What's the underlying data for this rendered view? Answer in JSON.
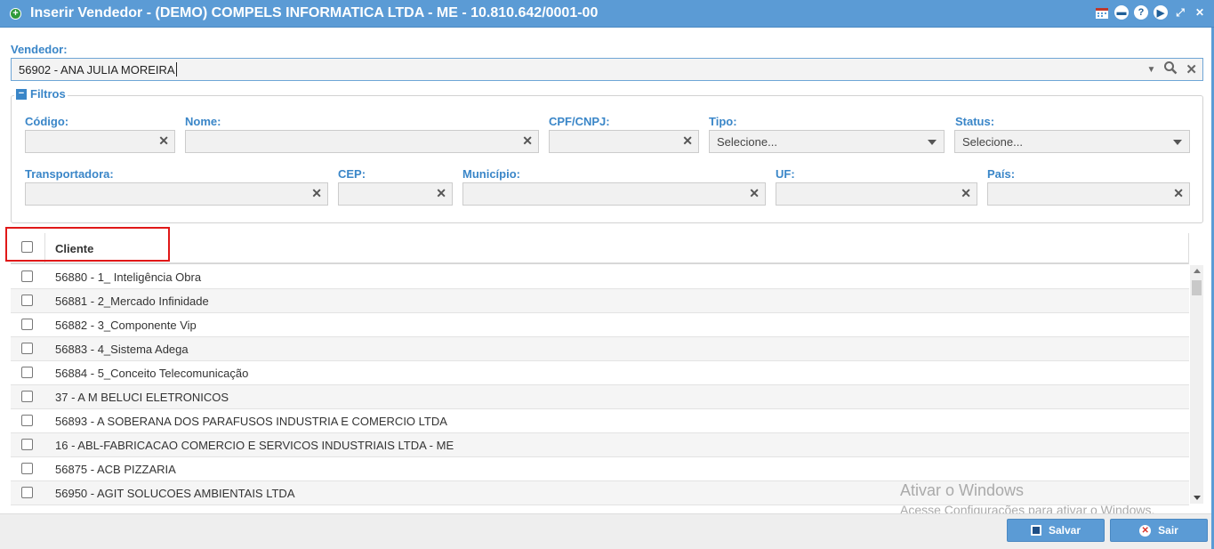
{
  "window": {
    "title": "Inserir Vendedor - (DEMO) COMPELS INFORMATICA LTDA - ME - 10.810.642/0001-00",
    "actions": [
      "calendar-icon",
      "minimize-icon",
      "help-icon",
      "play-icon",
      "expand-icon",
      "close-icon"
    ]
  },
  "vendedor": {
    "label": "Vendedor:",
    "value": "56902 - ANA JULIA MOREIRA"
  },
  "filtros": {
    "legend": "Filtros",
    "fields": {
      "codigo": {
        "label": "Código:",
        "value": ""
      },
      "nome": {
        "label": "Nome:",
        "value": ""
      },
      "cpf_cnpj": {
        "label": "CPF/CNPJ:",
        "value": ""
      },
      "tipo": {
        "label": "Tipo:",
        "value": "Selecione..."
      },
      "status": {
        "label": "Status:",
        "value": "Selecione..."
      },
      "transportadora": {
        "label": "Transportadora:",
        "value": ""
      },
      "cep": {
        "label": "CEP:",
        "value": ""
      },
      "municipio": {
        "label": "Município:",
        "value": ""
      },
      "uf": {
        "label": "UF:",
        "value": ""
      },
      "pais": {
        "label": "País:",
        "value": ""
      }
    }
  },
  "grid": {
    "column": "Cliente",
    "rows": [
      "56880 - 1_ Inteligência Obra",
      "56881 - 2_Mercado Infinidade",
      "56882 - 3_Componente Vip",
      "56883 - 4_Sistema Adega",
      "56884 - 5_Conceito Telecomunicação",
      "37 - A M BELUCI ELETRONICOS",
      "56893 - A SOBERANA DOS PARAFUSOS INDUSTRIA E COMERCIO LTDA",
      "16 - ABL-FABRICACAO COMERCIO E SERVICOS INDUSTRIAIS LTDA - ME",
      "56875 - ACB PIZZARIA",
      "56950 - AGIT SOLUCOES AMBIENTAIS LTDA"
    ]
  },
  "footer": {
    "save_label": "Salvar",
    "exit_label": "Sair"
  },
  "watermark": {
    "line1": "Ativar o Windows",
    "line2": "Acesse Configurações para ativar o Windows."
  },
  "colors": {
    "titlebar": "#5b9bd5",
    "label_blue": "#3a86c8",
    "highlight_red": "#e01818"
  }
}
